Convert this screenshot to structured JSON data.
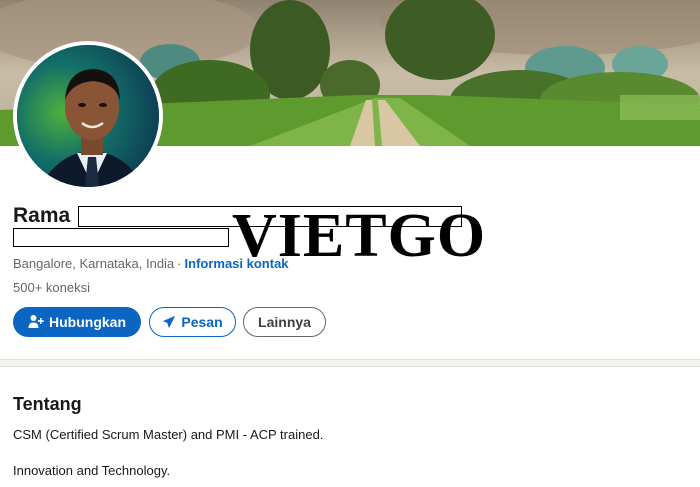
{
  "profile": {
    "name": "Rama",
    "location": "Bangalore, Karnataka, India",
    "separator": "·",
    "contact_info_link": "Informasi kontak",
    "connections": "500+ koneksi"
  },
  "watermark": "VIETGO",
  "actions": {
    "connect_label": "Hubungkan",
    "message_label": "Pesan",
    "more_label": "Lainnya"
  },
  "about": {
    "title": "Tentang",
    "line1": "CSM (Certified Scrum Master) and PMI - ACP trained.",
    "line2": "Innovation and Technology."
  },
  "icons": {
    "connect": "person-add-icon",
    "message": "paper-plane-icon"
  },
  "colors": {
    "brand_blue": "#0a66c2",
    "muted_text": "#666666",
    "primary_text": "#191919"
  }
}
